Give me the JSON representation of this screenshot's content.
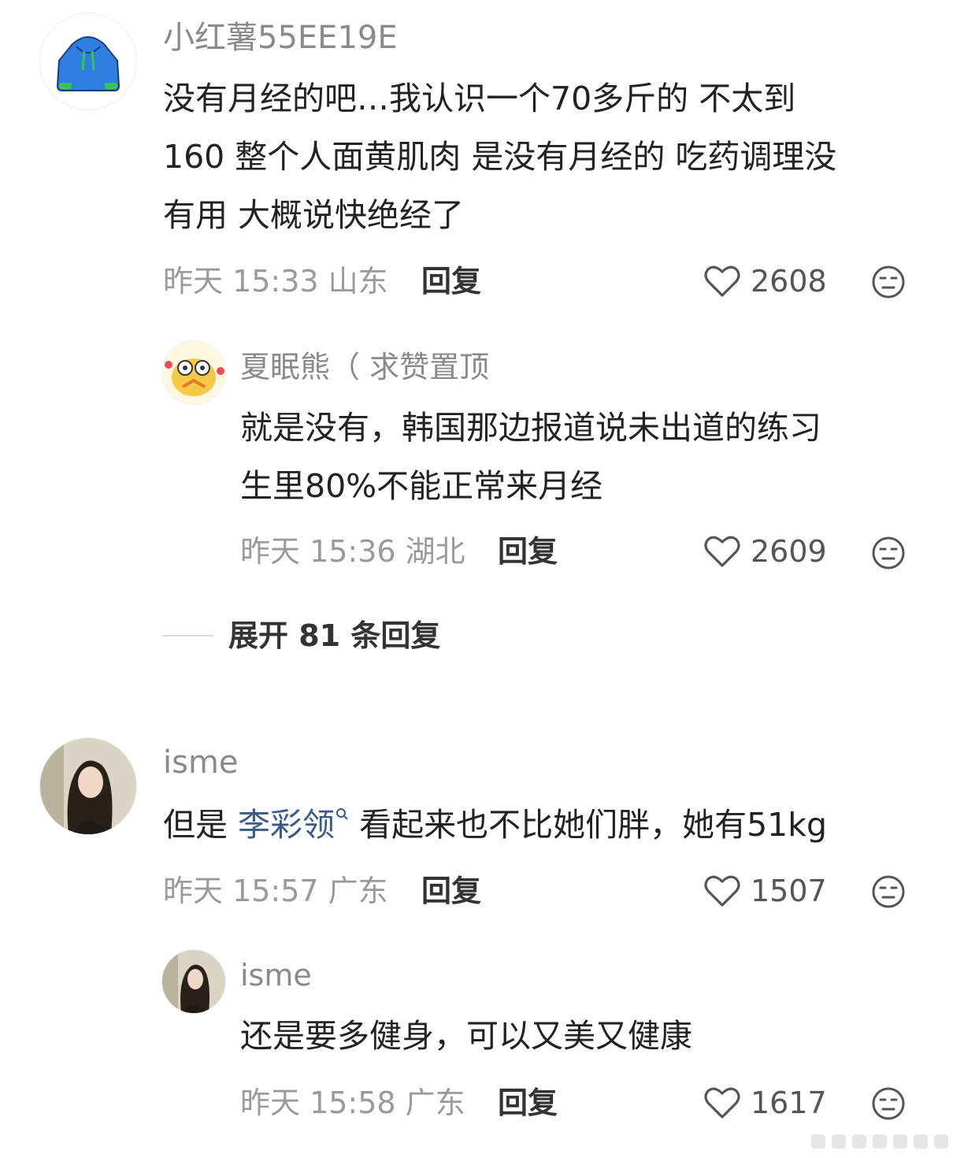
{
  "comments": [
    {
      "username": "小红薯55EE19E",
      "text_lines": [
        "没有月经的吧…我认识一个70多斤的 不太到",
        "160 整个人面黄肌肉 是没有月经的 吃药调理没",
        "有用  大概说快绝经了"
      ],
      "meta": "昨天 15:33 山东",
      "reply_label": "回复",
      "likes": "2608",
      "avatar_icon": "hoodie-icon"
    },
    {
      "username": "夏眠熊（ 求赞置顶",
      "text_lines": [
        "就是没有，韩国那边报道说未出道的练习",
        "生里80%不能正常来月经"
      ],
      "meta": "昨天 15:36 湖北",
      "reply_label": "回复",
      "likes": "2609",
      "avatar_icon": "sticker-avatar"
    },
    {
      "username": "isme",
      "text_prefix": "但是 ",
      "mention": "李彩领",
      "text_suffix": " 看起来也不比她们胖，她有51kg",
      "meta": "昨天 15:57 广东",
      "reply_label": "回复",
      "likes": "1507",
      "avatar_icon": "photo-avatar"
    },
    {
      "username": "isme",
      "text_lines": [
        "还是要多健身，可以又美又健康"
      ],
      "meta": "昨天 15:58 广东",
      "reply_label": "回复",
      "likes": "1617",
      "avatar_icon": "photo-avatar"
    }
  ],
  "expand_replies": "展开 81 条回复",
  "colors": {
    "mention": "#3a5a8c",
    "hoodie": "#2f7fe0",
    "hoodie_trim": "#39c45a"
  }
}
